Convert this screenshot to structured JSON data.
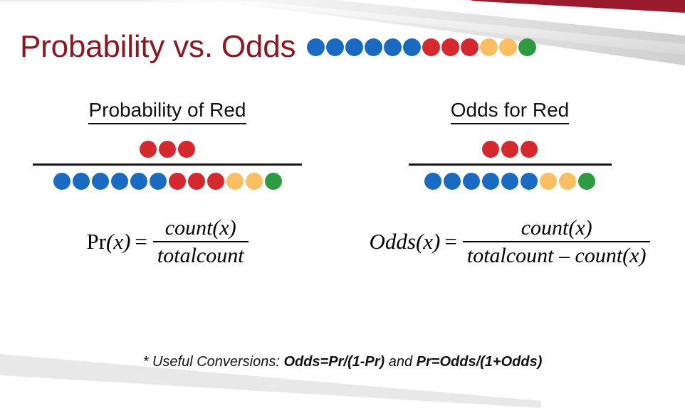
{
  "slide": {
    "title": "Probability vs. Odds",
    "footnote": {
      "prefix": "* Useful Conversions: ",
      "conversion_1": "Odds=Pr/(1-Pr)",
      "conjunction": " and  ",
      "conversion_2": "Pr=Odds/(1+Odds)"
    }
  },
  "colors": {
    "title_red": "#8C1723",
    "dot_blue": "#1B6AC2",
    "dot_red": "#D42A2F",
    "dot_orange": "#FBBE63",
    "dot_green": "#2E9B42",
    "rule_black": "#1A1414",
    "accent_banner": "#9B1B2E",
    "swoosh_gray": "#E8E8E8"
  },
  "title_dots": {
    "counts": {
      "blue": 6,
      "red": 3,
      "orange": 2,
      "green": 1
    },
    "total": 12,
    "sequence": [
      "blue",
      "blue",
      "blue",
      "blue",
      "blue",
      "blue",
      "red",
      "red",
      "red",
      "orange",
      "orange",
      "green"
    ]
  },
  "columns": [
    {
      "id": "probability",
      "heading": "Probability of Red",
      "numerator_dots": {
        "sequence": [
          "red",
          "red",
          "red"
        ],
        "counts": {
          "red": 3
        },
        "total": 3
      },
      "denominator_dots": {
        "sequence": [
          "blue",
          "blue",
          "blue",
          "blue",
          "blue",
          "blue",
          "red",
          "red",
          "red",
          "orange",
          "orange",
          "green"
        ],
        "counts": {
          "blue": 6,
          "red": 3,
          "orange": 2,
          "green": 1
        },
        "total": 12
      },
      "formula": {
        "lhs_function": "Pr",
        "lhs_arg": "(x)",
        "equals": "=",
        "numerator": "count(x)",
        "denominator": "totalcount"
      }
    },
    {
      "id": "odds",
      "heading": "Odds for Red",
      "numerator_dots": {
        "sequence": [
          "red",
          "red",
          "red"
        ],
        "counts": {
          "red": 3
        },
        "total": 3
      },
      "denominator_dots": {
        "sequence": [
          "blue",
          "blue",
          "blue",
          "blue",
          "blue",
          "blue",
          "orange",
          "orange",
          "green"
        ],
        "counts": {
          "blue": 6,
          "orange": 2,
          "green": 1
        },
        "total": 9
      },
      "formula": {
        "lhs_function": "Odds",
        "lhs_arg": "(x)",
        "equals": "=",
        "numerator": "count(x)",
        "denominator": "totalcount – count(x)"
      }
    }
  ]
}
